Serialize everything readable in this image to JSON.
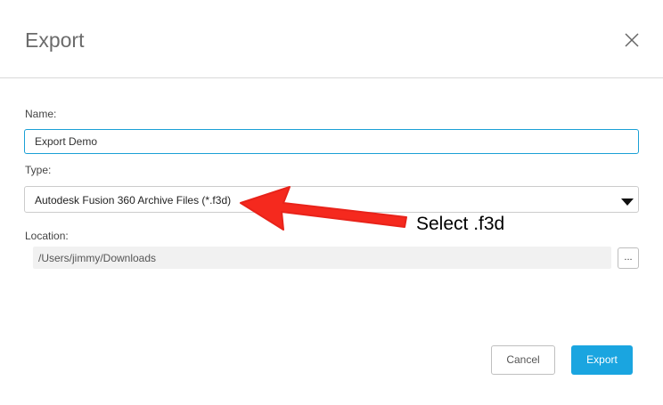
{
  "dialog": {
    "title": "Export",
    "close_icon": "close-icon"
  },
  "form": {
    "name_label": "Name:",
    "name_value": "Export Demo",
    "type_label": "Type:",
    "type_value": "Autodesk Fusion 360 Archive Files (*.f3d)",
    "type_caret_icon": "caret-down-icon",
    "location_label": "Location:",
    "location_value": "/Users/jimmy/Downloads",
    "browse_label": "..."
  },
  "footer": {
    "cancel_label": "Cancel",
    "export_label": "Export"
  },
  "annotation": {
    "text": "Select .f3d",
    "arrow_color": "#f5291e"
  },
  "colors": {
    "accent": "#1aa5e0",
    "input_focus_border": "#1aa0d6"
  }
}
